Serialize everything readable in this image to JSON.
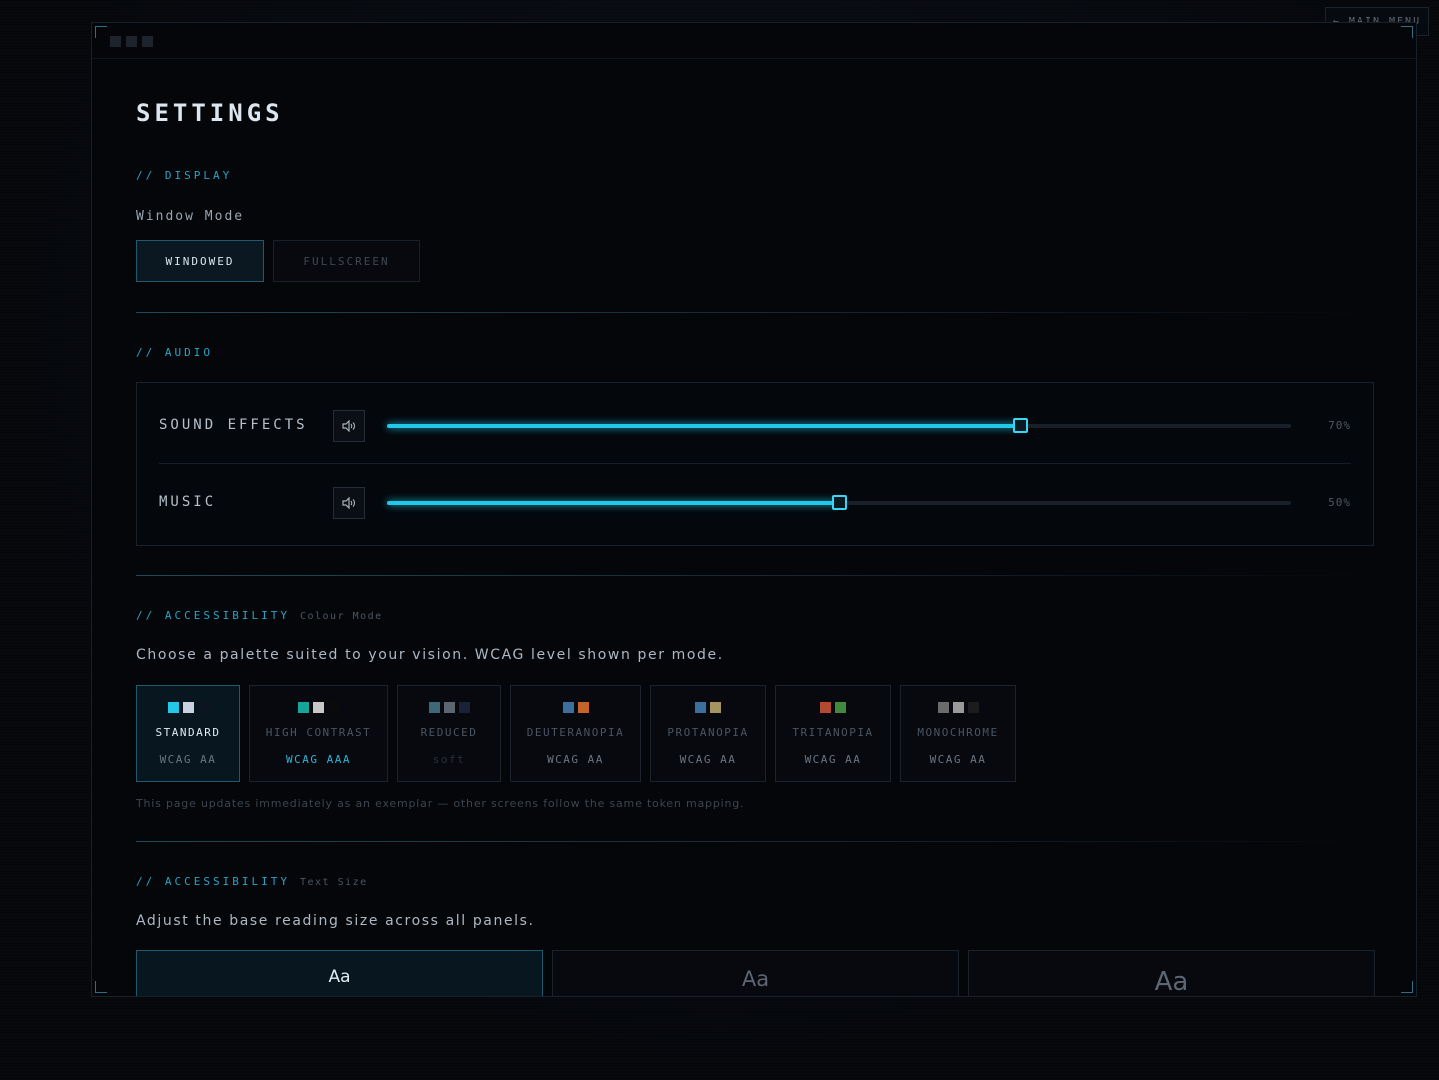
{
  "nav": {
    "main_menu": "← MAIN MENU"
  },
  "page": {
    "title": "SETTINGS"
  },
  "display": {
    "section_label": "// DISPLAY",
    "window_mode_label": "Window Mode",
    "modes": [
      {
        "label": "WINDOWED",
        "active": true
      },
      {
        "label": "FULLSCREEN",
        "active": false
      }
    ]
  },
  "audio": {
    "section_label": "// AUDIO",
    "channels": [
      {
        "name": "SOUND EFFECTS",
        "value": 70,
        "display": "70%"
      },
      {
        "name": "MUSIC",
        "value": 50,
        "display": "50%"
      }
    ]
  },
  "colour": {
    "section_label": "// ACCESSIBILITY",
    "section_sub": "Colour Mode",
    "description": "Choose a palette suited to your vision. WCAG level shown per mode.",
    "palettes": [
      {
        "name": "STANDARD",
        "level": "WCAG AA",
        "swatches": [
          "#22c8e8",
          "#c8d2e0",
          "#0b1420"
        ],
        "active": true
      },
      {
        "name": "HIGH CONTRAST",
        "level": "WCAG AAA",
        "swatches": [
          "#14a69a",
          "#c7c7c7",
          "#0a0a0a"
        ],
        "active": false
      },
      {
        "name": "REDUCED",
        "level": "soft",
        "swatches": [
          "#3e6878",
          "#5c6670",
          "#1a2238"
        ],
        "active": false
      },
      {
        "name": "DEUTERANOPIA",
        "level": "WCAG AA",
        "swatches": [
          "#3a6f9e",
          "#c5642a"
        ],
        "active": false
      },
      {
        "name": "PROTANOPIA",
        "level": "WCAG AA",
        "swatches": [
          "#3a6f9e",
          "#a89460"
        ],
        "active": false
      },
      {
        "name": "TRITANOPIA",
        "level": "WCAG AA",
        "swatches": [
          "#b14a2e",
          "#3f8a3c"
        ],
        "active": false
      },
      {
        "name": "MONOCHROME",
        "level": "WCAG AA",
        "swatches": [
          "#6b6b6b",
          "#9a9a9a",
          "#1c1c1c"
        ],
        "active": false
      }
    ],
    "note": "This page updates immediately as an exemplar — other screens follow the same token mapping."
  },
  "text_size": {
    "section_label": "// ACCESSIBILITY",
    "section_sub": "Text Size",
    "description": "Adjust the base reading size across all panels.",
    "options": [
      {
        "label": "Aa",
        "active": true
      },
      {
        "label": "Aa",
        "active": false
      },
      {
        "label": "Aa",
        "active": false
      }
    ]
  },
  "colors": {
    "accent": "#22c8e8",
    "panel": "#04060a",
    "border": "#1e5a6e"
  }
}
